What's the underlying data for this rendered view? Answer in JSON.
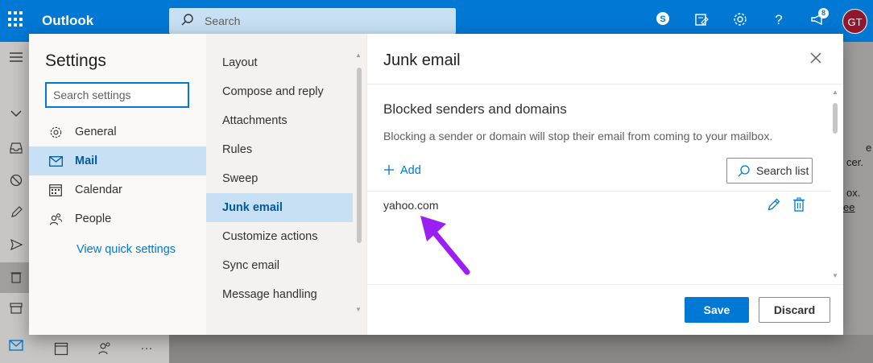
{
  "app": {
    "name": "Outlook",
    "search_placeholder": "Search",
    "notification_count": "8",
    "avatar_initials": "GT",
    "right_fragments": [
      "e",
      "cer.",
      "ox.",
      "ee"
    ]
  },
  "settings": {
    "title": "Settings",
    "search_placeholder": "Search settings",
    "categories": [
      {
        "label": "General",
        "icon": "gear-icon",
        "active": false
      },
      {
        "label": "Mail",
        "icon": "mail-icon",
        "active": true
      },
      {
        "label": "Calendar",
        "icon": "calendar-icon",
        "active": false
      },
      {
        "label": "People",
        "icon": "people-icon",
        "active": false
      }
    ],
    "quick_settings_link": "View quick settings",
    "subcategories": [
      {
        "label": "Layout",
        "active": false
      },
      {
        "label": "Compose and reply",
        "active": false
      },
      {
        "label": "Attachments",
        "active": false
      },
      {
        "label": "Rules",
        "active": false
      },
      {
        "label": "Sweep",
        "active": false
      },
      {
        "label": "Junk email",
        "active": true
      },
      {
        "label": "Customize actions",
        "active": false
      },
      {
        "label": "Sync email",
        "active": false
      },
      {
        "label": "Message handling",
        "active": false
      }
    ]
  },
  "junk_email": {
    "title": "Junk email",
    "section_title": "Blocked senders and domains",
    "description": "Blocking a sender or domain will stop their email from coming to your mailbox.",
    "add_label": "Add",
    "search_list_label": "Search list",
    "blocked": [
      {
        "value": "yahoo.com"
      }
    ],
    "save_label": "Save",
    "discard_label": "Discard"
  },
  "colors": {
    "accent": "#0078d4",
    "selection": "#c7e0f4",
    "annotation_arrow": "#9b1ff5",
    "avatar": "#8e192e"
  }
}
